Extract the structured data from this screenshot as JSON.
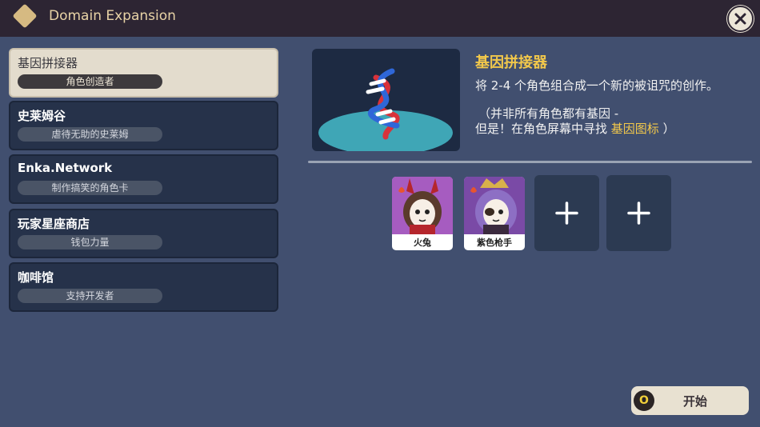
{
  "window": {
    "title": "Domain Expansion"
  },
  "menu": {
    "items": [
      {
        "title": "基因拼接器",
        "subtitle": "角色创造者",
        "active": true
      },
      {
        "title": "史莱姆谷",
        "subtitle": "虐待无助的史莱姆",
        "active": false
      },
      {
        "title": "Enka.Network",
        "subtitle": "制作搞笑的角色卡",
        "active": false
      },
      {
        "title": "玩家星座商店",
        "subtitle": "钱包力量",
        "active": false
      },
      {
        "title": "咖啡馆",
        "subtitle": "支持开发者",
        "active": false
      }
    ]
  },
  "detail": {
    "title": "基因拼接器",
    "description": "将 2-4 个角色组合成一个新的被诅咒的创作。",
    "note_line1": "（并非所有角色都有基因 -",
    "note_line2_prefix": "但是！在角色屏幕中寻找 ",
    "note_link": "基因图标",
    "note_line2_suffix": " ）"
  },
  "slots": {
    "characters": [
      {
        "name": "火兔",
        "element_icon": "pyro-icon"
      },
      {
        "name": "紫色枪手",
        "element_icon": "pyro-icon"
      }
    ],
    "empty_count": 2
  },
  "start_button": {
    "key": "O",
    "label": "开始"
  },
  "colors": {
    "accent": "#f2c84b",
    "background": "#414f6f",
    "titlebar": "#2d2533",
    "panel": "#26324a"
  }
}
